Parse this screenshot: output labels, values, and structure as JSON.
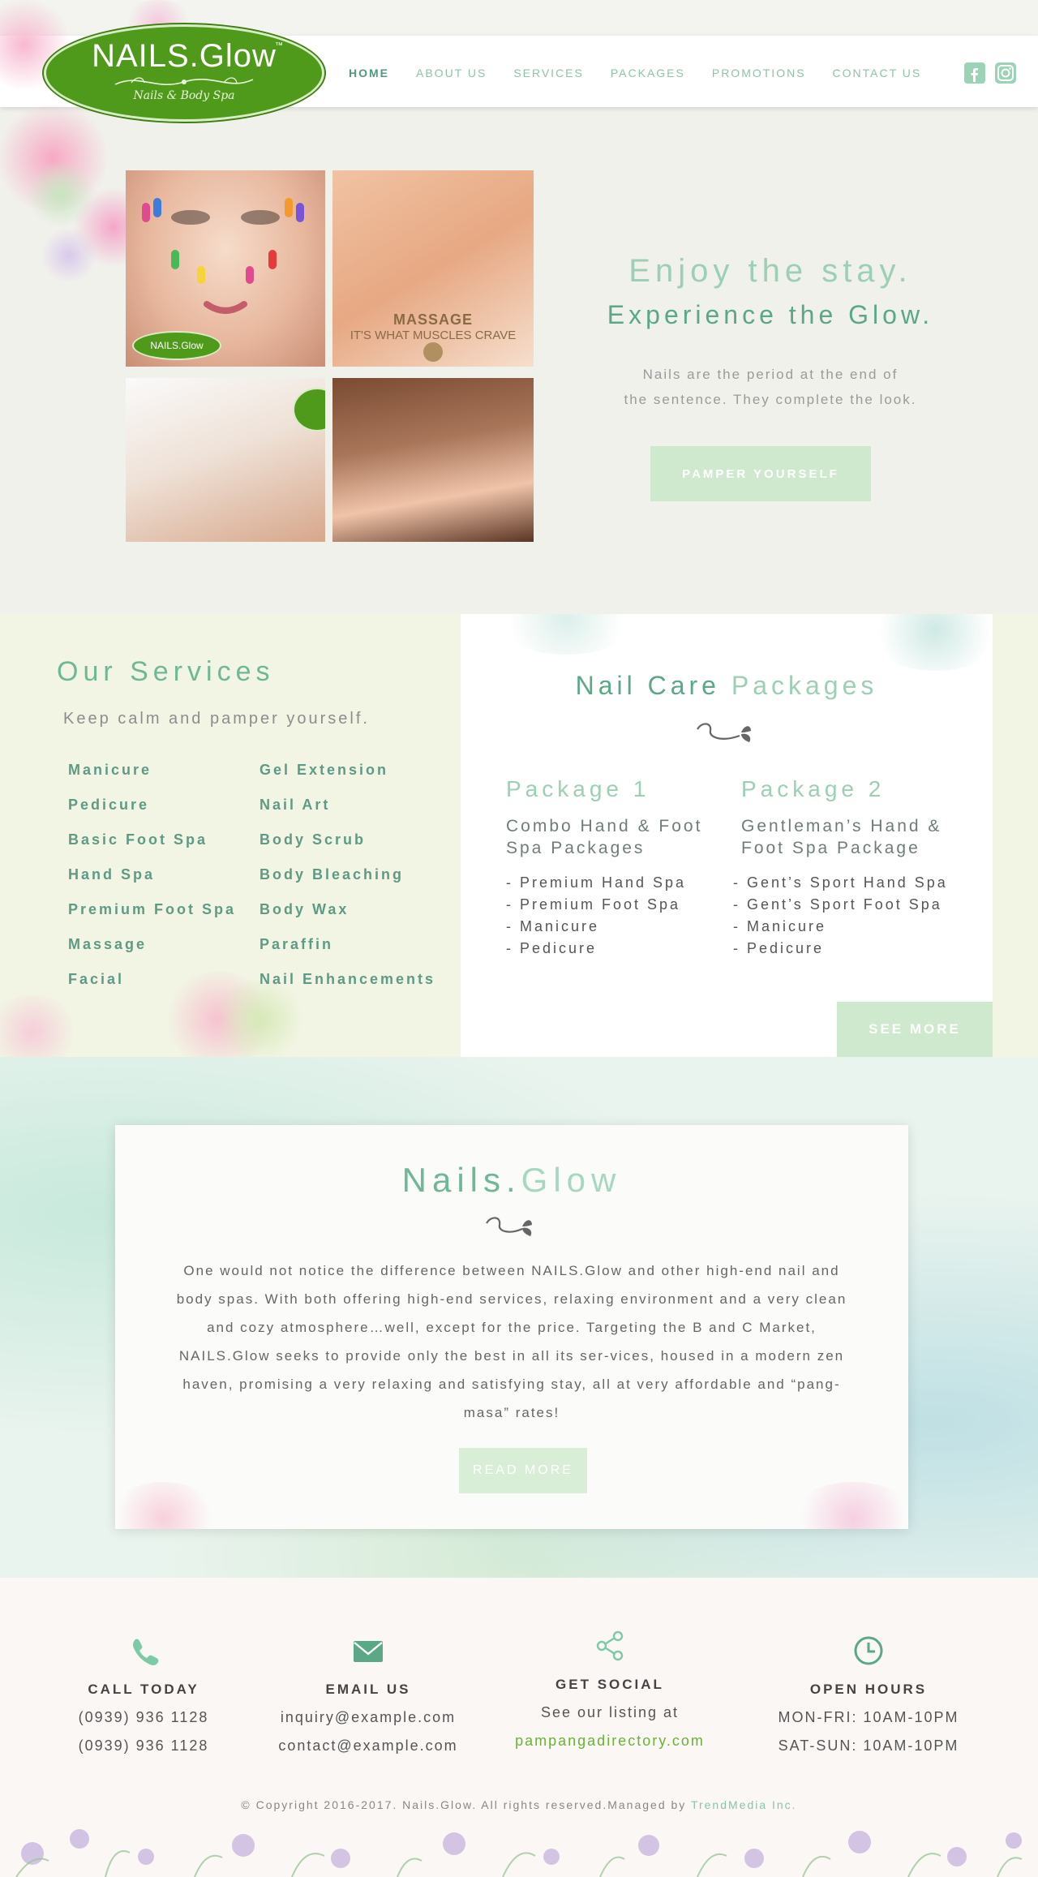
{
  "logo": {
    "title": "NAILS.Glow",
    "tm": "™",
    "subtitle": "Nails & Body Spa"
  },
  "nav": {
    "items": [
      "HOME",
      "ABOUT US",
      "SERVICES",
      "PACKAGES",
      "PROMOTIONS",
      "CONTACT US"
    ],
    "active": "HOME"
  },
  "social": {
    "facebook_icon": "facebook-icon",
    "instagram_icon": "instagram-icon"
  },
  "hero": {
    "tiles": {
      "badge": "NAILS.Glow",
      "massage_title": "MASSAGE",
      "massage_caption": "IT'S WHAT MUSCLES CRAVE"
    },
    "headline": "Enjoy the stay.",
    "subheadline": "Experience the Glow.",
    "tagline_line1": "Nails are the period at the end of",
    "tagline_line2": "the sentence. They complete the look.",
    "button": "PAMPER YOURSELF"
  },
  "services": {
    "title": "Our Services",
    "subtitle": "Keep calm and pamper yourself.",
    "col1": [
      "Manicure",
      "Pedicure",
      "Basic Foot Spa",
      "Hand Spa",
      "Premium Foot Spa",
      "Massage",
      "Facial"
    ],
    "col2": [
      "Gel Extension",
      "Nail Art",
      "Body Scrub",
      "Body Bleaching",
      "Body Wax",
      "Paraffin",
      "Nail Enhancements"
    ]
  },
  "packages": {
    "title_a": "Nail Care",
    "title_b": "Packages",
    "list": [
      {
        "name": "Package 1",
        "title": "Combo Hand & Foot Spa Packages",
        "items": [
          "- Premium Hand Spa",
          "- Premium Foot Spa",
          "- Manicure",
          "- Pedicure"
        ]
      },
      {
        "name": "Package 2",
        "title": "Gentleman’s Hand & Foot Spa Package",
        "items": [
          "- Gent’s Sport Hand Spa",
          "- Gent’s Sport Foot Spa",
          "- Manicure",
          "- Pedicure"
        ]
      }
    ],
    "button": "SEE MORE"
  },
  "about": {
    "title_a": "Nails",
    "title_dot": ".",
    "title_b": "Glow",
    "text": "One would not notice the difference between NAILS.Glow and other high-end nail and body spas. With both offering high-end services, relaxing environment and a very clean and cozy atmosphere…well, except for the price. Targeting the B and C Market, NAILS.Glow seeks to provide only the best in all its ser-vices, housed in a modern zen haven, promising a very relaxing and satisfying stay, all at very affordable and “pang-masa” rates!",
    "button": "READ MORE"
  },
  "footer": {
    "call": {
      "title": "CALL TODAY",
      "line1": "(0939) 936 1128",
      "line2": "(0939) 936 1128",
      "icon": "phone-icon"
    },
    "email": {
      "title": "EMAIL US",
      "line1": "inquiry@example.com",
      "line2": "contact@example.com",
      "icon": "envelope-icon"
    },
    "social": {
      "title": "GET SOCIAL",
      "line1": "See our listing at",
      "link": "pampangadirectory.com",
      "icon": "share-icon"
    },
    "hours": {
      "title": "OPEN HOURS",
      "line1": "MON-FRI: 10AM-10PM",
      "line2": "SAT-SUN: 10AM-10PM",
      "icon": "clock-icon"
    },
    "copyright": "© Copyright 2016-2017. Nails.Glow. All rights reserved.Managed by",
    "managed_by": "TrendMedia Inc."
  },
  "colors": {
    "accent_green": "#6fb796",
    "dark_green": "#5aa886",
    "button_green": "#cfe9cf",
    "logo_green": "#4f9a1a",
    "link_green": "#6bb13a"
  }
}
